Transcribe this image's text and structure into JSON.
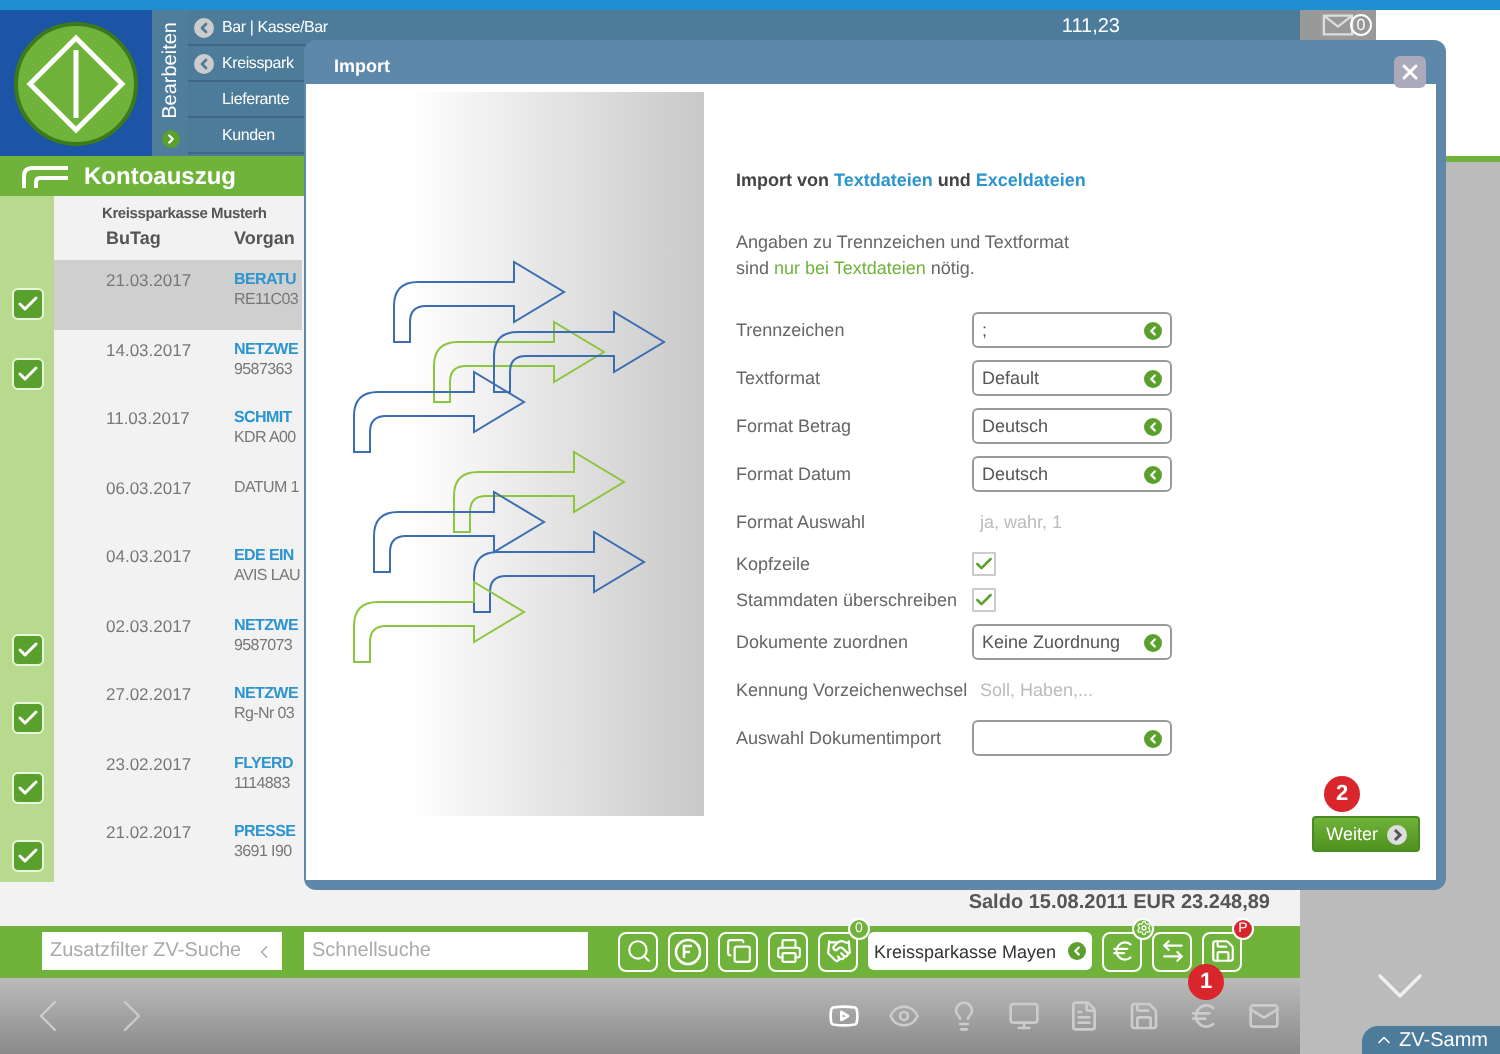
{
  "header": {
    "edit_label": "Bearbeiten",
    "nav_items": [
      {
        "label": "Bar | Kasse/Bar",
        "arrow": true
      },
      {
        "label": "Kreisspark",
        "arrow": true
      },
      {
        "label": "Lieferante",
        "arrow": false
      },
      {
        "label": "Kunden",
        "arrow": false
      }
    ],
    "amount": "111,23",
    "mail_badge": "0"
  },
  "panel": {
    "title": "Kontoauszug",
    "bank": "Kreissparkasse Musterh",
    "columns": [
      "BuTag",
      "Vorgan"
    ],
    "rows": [
      {
        "date": "21.03.2017",
        "title": "BERATU",
        "detail": "RE11C03",
        "selected": true,
        "booked": true
      },
      {
        "date": "14.03.2017",
        "title": "NETZWE",
        "detail": "9587363",
        "selected": false,
        "booked": true
      },
      {
        "date": "11.03.2017",
        "title": "SCHMIT",
        "detail": "KDR A00",
        "selected": false,
        "booked": false
      },
      {
        "date": "06.03.2017",
        "title": "",
        "detail": "DATUM 1",
        "selected": false,
        "booked": false
      },
      {
        "date": "04.03.2017",
        "title": "EDE EIN",
        "detail": "AVIS LAU",
        "selected": false,
        "booked": false
      },
      {
        "date": "02.03.2017",
        "title": "NETZWE",
        "detail": "9587073",
        "selected": false,
        "booked": true
      },
      {
        "date": "27.02.2017",
        "title": "NETZWE",
        "detail": "Rg-Nr 03",
        "selected": false,
        "booked": true
      },
      {
        "date": "23.02.2017",
        "title": "FLYERD",
        "detail": "1114883",
        "selected": false,
        "booked": true
      },
      {
        "date": "21.02.2017",
        "title": "PRESSE",
        "detail": "3691 I90",
        "selected": false,
        "booked": true
      }
    ],
    "saldo": "Saldo 15.08.2011 EUR 23.248,89"
  },
  "toolbar": {
    "filter_placeholder": "Zusatzfilter ZV-Suche",
    "search_placeholder": "Schnellsuche",
    "handshake_badge": "0",
    "bank_select": "Kreissparkasse Mayen",
    "save_badge": "P",
    "callout": "1"
  },
  "side_tab": "ZV-Samm",
  "dialog": {
    "tab": "Import",
    "heading": [
      {
        "text": "Import von ",
        "highlight": false
      },
      {
        "text": "Textdateien",
        "highlight": true
      },
      {
        "text": " und ",
        "highlight": false
      },
      {
        "text": "Exceldateien",
        "highlight": true
      }
    ],
    "note_line1": "Angaben zu Trennzeichen und Textformat",
    "note_line2": [
      {
        "text": "sind ",
        "highlight": false
      },
      {
        "text": "nur bei Textdateien",
        "highlight": true
      },
      {
        "text": " nötig.",
        "highlight": false
      }
    ],
    "fields": [
      {
        "kind": "select",
        "label": "Trennzeichen",
        "value": ";"
      },
      {
        "kind": "select",
        "label": "Textformat",
        "value": "Default"
      },
      {
        "kind": "select",
        "label": "Format Betrag",
        "value": "Deutsch"
      },
      {
        "kind": "select",
        "label": "Format Datum",
        "value": "Deutsch"
      },
      {
        "kind": "hint",
        "label": "Format Auswahl",
        "placeholder": "ja, wahr, 1"
      },
      {
        "kind": "checkbox",
        "label": "Kopfzeile",
        "checked": true
      },
      {
        "kind": "checkbox",
        "label": "Stammdaten überschreiben",
        "checked": true
      },
      {
        "kind": "select",
        "label": "Dokumente zuordnen",
        "value": "Keine Zuordnung"
      },
      {
        "kind": "hint",
        "label": "Kennung Vorzeichenwechsel",
        "placeholder": "Soll, Haben,..."
      },
      {
        "kind": "select",
        "label": "Auswahl Dokumentimport"
      }
    ],
    "next_button": "Weiter",
    "callout": "2"
  }
}
